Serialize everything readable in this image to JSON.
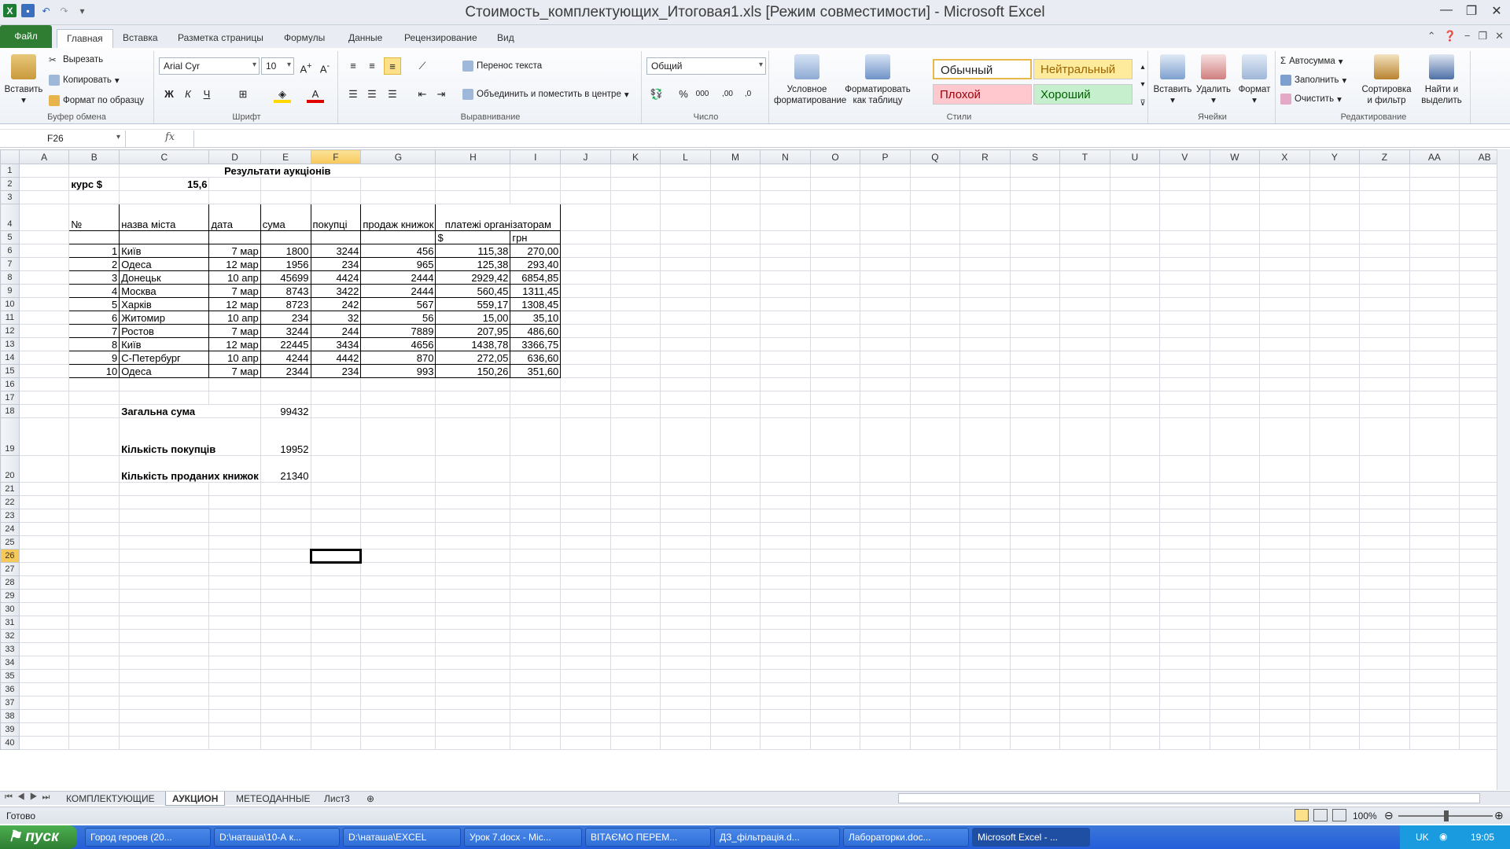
{
  "window": {
    "title": "Стоимость_комплектующих_Итоговая1.xls  [Режим совместимости]  -  Microsoft Excel"
  },
  "ribbon_tabs": [
    "Файл",
    "Главная",
    "Вставка",
    "Разметка страницы",
    "Формулы",
    "Данные",
    "Рецензирование",
    "Вид"
  ],
  "ribbon": {
    "clipboard": {
      "paste": "Вставить",
      "cut": "Вырезать",
      "copy": "Копировать",
      "format_painter": "Формат по образцу",
      "label": "Буфер обмена"
    },
    "font": {
      "name": "Arial Cyr",
      "size": "10",
      "label": "Шрифт"
    },
    "alignment": {
      "wrap": "Перенос текста",
      "merge": "Объединить и поместить в центре",
      "label": "Выравнивание"
    },
    "number": {
      "format": "Общий",
      "label": "Число"
    },
    "styles": {
      "conditional": "Условное форматирование",
      "as_table": "Форматировать как таблицу",
      "normal": "Обычный",
      "neutral": "Нейтральный",
      "bad": "Плохой",
      "good": "Хороший",
      "label": "Стили"
    },
    "cells": {
      "insert": "Вставить",
      "delete": "Удалить",
      "format": "Формат",
      "label": "Ячейки"
    },
    "editing": {
      "autosum": "Автосумма",
      "fill": "Заполнить",
      "clear": "Очистить",
      "sort": "Сортировка и фильтр",
      "find": "Найти и выделить",
      "label": "Редактирование"
    }
  },
  "formula_bar": {
    "name_box": "F26",
    "fx": "fx",
    "content": ""
  },
  "columns": [
    "A",
    "B",
    "C",
    "D",
    "E",
    "F",
    "G",
    "H",
    "I",
    "J",
    "K",
    "L",
    "M",
    "N",
    "O",
    "P",
    "Q",
    "R",
    "S",
    "T",
    "U",
    "V",
    "W",
    "X",
    "Y",
    "Z",
    "AA",
    "AB"
  ],
  "sheet": {
    "title": "Результати аукціонів",
    "rate_label": "курс $",
    "rate_value": "15,6",
    "headers": {
      "num": "№",
      "city": "назва міста",
      "date": "дата",
      "sum": "сума",
      "buyers": "покупці",
      "sold": "продаж книжок",
      "payments": "платежі організаторам",
      "usd": "$",
      "uah": "грн"
    },
    "rows": [
      {
        "n": "1",
        "city": "Київ",
        "date": "7 мар",
        "sum": "1800",
        "buyers": "3244",
        "sold": "456",
        "usd": "115,38",
        "uah": "270,00"
      },
      {
        "n": "2",
        "city": "Одеса",
        "date": "12 мар",
        "sum": "1956",
        "buyers": "234",
        "sold": "965",
        "usd": "125,38",
        "uah": "293,40"
      },
      {
        "n": "3",
        "city": "Донецьк",
        "date": "10 апр",
        "sum": "45699",
        "buyers": "4424",
        "sold": "2444",
        "usd": "2929,42",
        "uah": "6854,85"
      },
      {
        "n": "4",
        "city": "Москва",
        "date": "7 мар",
        "sum": "8743",
        "buyers": "3422",
        "sold": "2444",
        "usd": "560,45",
        "uah": "1311,45"
      },
      {
        "n": "5",
        "city": "Харків",
        "date": "12 мар",
        "sum": "8723",
        "buyers": "242",
        "sold": "567",
        "usd": "559,17",
        "uah": "1308,45"
      },
      {
        "n": "6",
        "city": "Житомир",
        "date": "10 апр",
        "sum": "234",
        "buyers": "32",
        "sold": "56",
        "usd": "15,00",
        "uah": "35,10"
      },
      {
        "n": "7",
        "city": "Ростов",
        "date": "7 мар",
        "sum": "3244",
        "buyers": "244",
        "sold": "7889",
        "usd": "207,95",
        "uah": "486,60"
      },
      {
        "n": "8",
        "city": "Київ",
        "date": "12 мар",
        "sum": "22445",
        "buyers": "3434",
        "sold": "4656",
        "usd": "1438,78",
        "uah": "3366,75"
      },
      {
        "n": "9",
        "city": "С-Петербург",
        "date": "10 апр",
        "sum": "4244",
        "buyers": "4442",
        "sold": "870",
        "usd": "272,05",
        "uah": "636,60"
      },
      {
        "n": "10",
        "city": "Одеса",
        "date": "7 мар",
        "sum": "2344",
        "buyers": "234",
        "sold": "993",
        "usd": "150,26",
        "uah": "351,60"
      }
    ],
    "summary": [
      {
        "label": "Загальна сума",
        "value": "99432"
      },
      {
        "label": "Кількість покупців",
        "value": "19952"
      },
      {
        "label": "Кількість проданих книжок",
        "value": "21340"
      }
    ]
  },
  "sheet_tabs": [
    "КОМПЛЕКТУЮЩИЕ",
    "АУКЦИОН",
    "МЕТЕОДАННЫЕ",
    "Лист3"
  ],
  "status": {
    "ready": "Готово",
    "zoom": "100%"
  },
  "taskbar": {
    "start": "пуск",
    "items": [
      "Город героев (20...",
      "D:\\наташа\\10-А к...",
      "D:\\наташа\\EXCEL",
      "Урок 7.docx - Mic...",
      "ВІТАЄМО ПЕРЕМ...",
      "ДЗ_фільтрація.d...",
      "Лабораторки.doc...",
      "Microsoft Excel - ..."
    ],
    "lang": "UK",
    "time": "19:05"
  },
  "colors": {
    "file_tab": "#2e7d32",
    "taskbar": "#245edb",
    "style_neutral": "#ffeb9c",
    "style_bad": "#ffc7ce",
    "style_good": "#c6efce"
  }
}
